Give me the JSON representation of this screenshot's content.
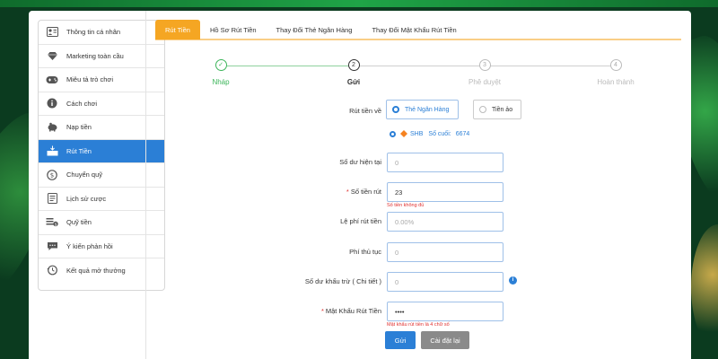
{
  "sidebar": {
    "items": [
      {
        "label": "Thông tin cá nhân",
        "icon": "user-card-icon"
      },
      {
        "label": "Marketing toàn cầu",
        "icon": "diamond-icon"
      },
      {
        "label": "Miêu tả trò chơi",
        "icon": "gamepad-icon"
      },
      {
        "label": "Cách chơi",
        "icon": "info-icon"
      },
      {
        "label": "Nạp tiền",
        "icon": "piggy-bank-icon"
      },
      {
        "label": "Rút Tiền",
        "icon": "withdraw-icon",
        "active": true
      },
      {
        "label": "Chuyển quỹ",
        "icon": "dollar-circle-icon"
      },
      {
        "label": "Lịch sử cược",
        "icon": "history-list-icon"
      },
      {
        "label": "Quỹ tiền",
        "icon": "money-icon"
      },
      {
        "label": "Ý kiến phản hồi",
        "icon": "chat-bubble-icon"
      },
      {
        "label": "Kết quả mở thưởng",
        "icon": "clock-history-icon"
      }
    ]
  },
  "tabs": [
    {
      "label": "Rút Tiền",
      "active": true
    },
    {
      "label": "Hồ Sơ Rút Tiền"
    },
    {
      "label": "Thay Đổi Thẻ Ngân Hàng"
    },
    {
      "label": "Thay Đổi Mật Khẩu Rút Tiền"
    }
  ],
  "steps": [
    {
      "num": "✓",
      "label": "Nháp",
      "state": "done"
    },
    {
      "num": "2",
      "label": "Gửi",
      "state": "current"
    },
    {
      "num": "3",
      "label": "Phê duyệt",
      "state": "pending"
    },
    {
      "num": "4",
      "label": "Hoàn thành",
      "state": "pending"
    }
  ],
  "form": {
    "withdraw_to_label": "Rút tiền về",
    "option_bank": "Thẻ Ngân Hàng",
    "option_virtual": "Tiền ảo",
    "bank_name": "SHB",
    "last_digits_label": "Số cuối:",
    "last_digits": "6674",
    "balance_label": "Số dư hiện tại",
    "balance_value": "0",
    "amount_label": "Số tiền rút",
    "amount_value": "23",
    "amount_error": "Số tiền không đủ",
    "fee_label": "Lệ phí rút tiền",
    "fee_placeholder": "0.00%",
    "procedure_fee_label": "Phí thủ tục",
    "procedure_fee_value": "0",
    "deducted_balance_label": "Số dư khấu trừ ( Chi tiết )",
    "deducted_balance_value": "0",
    "password_label": "Mật Khẩu Rút Tiền",
    "password_value": "••••",
    "password_error": "Mật khẩu rút tiền là 4 chữ số",
    "submit_label": "Gửi",
    "reset_label": "Cài đặt lại"
  },
  "colors": {
    "accent": "#f5a623",
    "primary": "#2b7fd6",
    "success": "#3cb55a",
    "error": "#e0302f"
  }
}
